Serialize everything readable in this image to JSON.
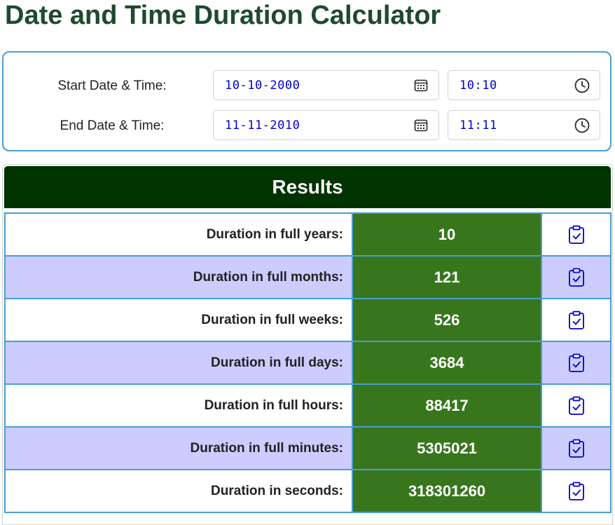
{
  "page": {
    "title": "Date and Time Duration Calculator"
  },
  "inputs": {
    "start": {
      "label": "Start Date & Time:",
      "date": "10-10-2000",
      "time": "10:10"
    },
    "end": {
      "label": "End Date & Time:",
      "date": "11-11-2010",
      "time": "11:11"
    }
  },
  "results": {
    "title": "Results",
    "rows": [
      {
        "label": "Duration in full years:",
        "value": "10"
      },
      {
        "label": "Duration in full months:",
        "value": "121"
      },
      {
        "label": "Duration in full weeks:",
        "value": "526"
      },
      {
        "label": "Duration in full days:",
        "value": "3684"
      },
      {
        "label": "Duration in full hours:",
        "value": "88417"
      },
      {
        "label": "Duration in full minutes:",
        "value": "5305021"
      },
      {
        "label": "Duration in seconds:",
        "value": "318301260"
      }
    ]
  },
  "icons": {
    "date_picker": "calendar-icon",
    "time_picker": "clock-icon",
    "copy": "clipboard-check-icon"
  },
  "colors": {
    "title": "#1e4a2d",
    "panel_border": "#4a9dd1",
    "results_header_bg": "#003300",
    "value_cell_bg": "#38761d",
    "alt_row_bg": "#ccccff",
    "input_text": "#0000cc",
    "copy_icon": "#0000cc"
  }
}
